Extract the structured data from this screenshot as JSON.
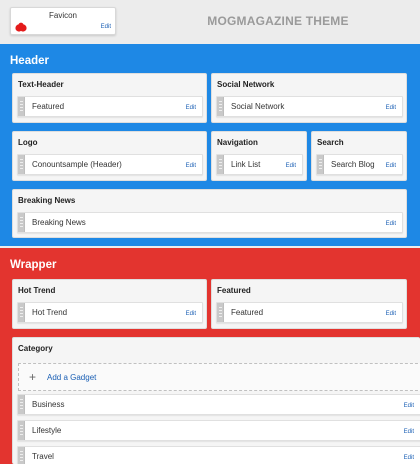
{
  "favicon": {
    "title": "Favicon",
    "edit": "Edit"
  },
  "theme_title": "MOGMAGAZINE THEME",
  "header_section": {
    "title": "Header",
    "panels": {
      "text_header": {
        "title": "Text-Header",
        "widget": "Featured",
        "edit": "Edit"
      },
      "social_network": {
        "title": "Social Network",
        "widget": "Social Network",
        "edit": "Edit"
      },
      "logo": {
        "title": "Logo",
        "widget": "Conountsample (Header)",
        "edit": "Edit"
      },
      "navigation": {
        "title": "Navigation",
        "widget": "Link List",
        "edit": "Edit"
      },
      "search": {
        "title": "Search",
        "widget": "Search Blog",
        "edit": "Edit"
      },
      "breaking_news": {
        "title": "Breaking News",
        "widget": "Breaking News",
        "edit": "Edit"
      }
    }
  },
  "wrapper_section": {
    "title": "Wrapper",
    "panels": {
      "hot_trend": {
        "title": "Hot Trend",
        "widget": "Hot Trend",
        "edit": "Edit"
      },
      "featured": {
        "title": "Featured",
        "widget": "Featured",
        "edit": "Edit"
      },
      "category": {
        "title": "Category",
        "add_gadget": "Add a Gadget",
        "widgets": [
          {
            "label": "Business",
            "edit": "Edit"
          },
          {
            "label": "Lifestyle",
            "edit": "Edit"
          },
          {
            "label": "Travel",
            "edit": "Edit"
          }
        ]
      }
    }
  },
  "colors": {
    "header_bg": "#1e88e5",
    "wrapper_bg": "#e3342f",
    "page_bg": "#ececec",
    "edit_link": "#1a5fb4"
  }
}
